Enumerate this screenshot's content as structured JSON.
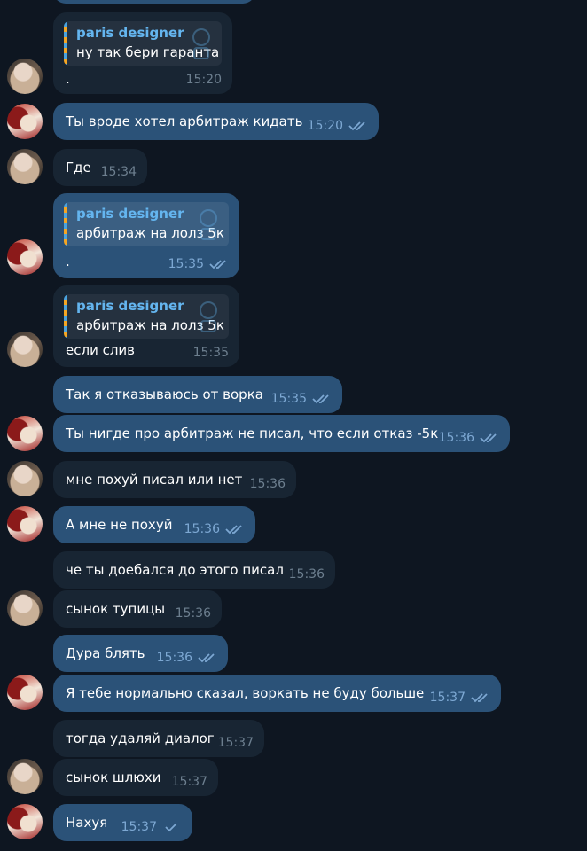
{
  "colors": {
    "background": "#0e1621",
    "incoming_bubble": "#182533",
    "outgoing_bubble": "#2b5278",
    "quote_name": "#64b5ef",
    "check": "#7da8d3"
  },
  "messages": [
    {
      "type": "in",
      "quote": {
        "name": "paris designer",
        "text": "ну так бери гаранта"
      },
      "text": ".",
      "time": "15:20"
    },
    {
      "type": "out",
      "text": "Ты вроде хотел арбитраж кидать",
      "time": "15:20",
      "status": "read"
    },
    {
      "type": "in",
      "text": "Где",
      "time": "15:34"
    },
    {
      "type": "out",
      "quote": {
        "name": "paris designer",
        "text": "арбитраж на лолз 5к"
      },
      "text": ".",
      "time": "15:35",
      "status": "read"
    },
    {
      "type": "in",
      "quote": {
        "name": "paris designer",
        "text": "арбитраж на лолз 5к"
      },
      "text": "если слив",
      "time": "15:35"
    },
    {
      "type": "out",
      "text": "Так я отказываюсь от ворка",
      "time": "15:35",
      "status": "read"
    },
    {
      "type": "out",
      "text": "Ты нигде про арбитраж не писал, что если отказ -5к",
      "time": "15:36",
      "status": "read"
    },
    {
      "type": "in",
      "text": "мне похуй писал или нет",
      "time": "15:36"
    },
    {
      "type": "out",
      "text": "А мне не похуй",
      "time": "15:36",
      "status": "read"
    },
    {
      "type": "in",
      "text": "че ты доебался до этого писал",
      "time": "15:36"
    },
    {
      "type": "in",
      "text": "сынок тупицы",
      "time": "15:36"
    },
    {
      "type": "out",
      "text": "Дура блять",
      "time": "15:36",
      "status": "read"
    },
    {
      "type": "out",
      "text": "Я тебе нормально сказал, воркать не буду больше",
      "time": "15:37",
      "status": "read"
    },
    {
      "type": "in",
      "text": "тогда удаляй диалог",
      "time": "15:37"
    },
    {
      "type": "in",
      "text": "сынок шлюхи",
      "time": "15:37"
    },
    {
      "type": "out",
      "text": "Нахуя",
      "time": "15:37",
      "status": "sent"
    }
  ]
}
